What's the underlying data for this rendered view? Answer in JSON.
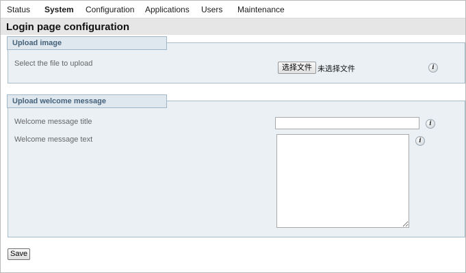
{
  "nav": {
    "items": [
      "Status",
      "System",
      "Configuration",
      "Applications",
      "Users",
      "Maintenance"
    ],
    "active": "System"
  },
  "page_title": "Login page configuration",
  "upload_image": {
    "legend": "Upload image",
    "label": "Select the file to upload",
    "button_label": "选择文件",
    "status": "未选择文件",
    "info_icon": "info-icon"
  },
  "welcome": {
    "legend": "Upload welcome message",
    "title_label": "Welcome message title",
    "title_value": "",
    "text_label": "Welcome message text",
    "text_value": "",
    "info_icon": "info-icon"
  },
  "save_label": "Save"
}
